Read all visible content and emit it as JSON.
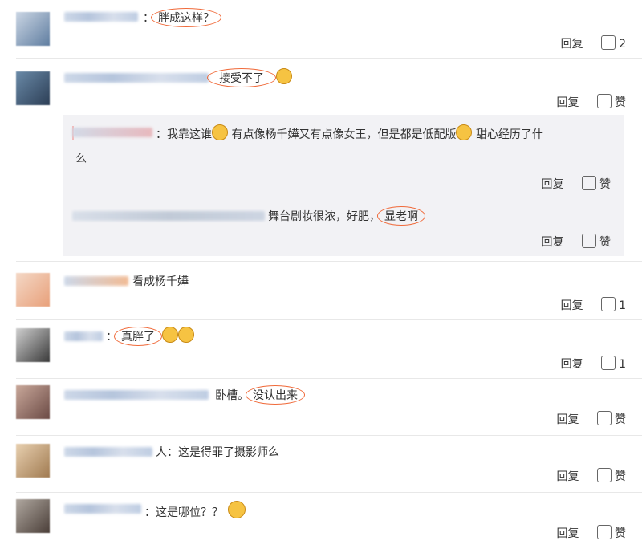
{
  "comments": [
    {
      "text": "：",
      "highlight": "胖成这样？",
      "reply": "回复",
      "like": "2"
    },
    {
      "text": "",
      "highlight": "接受不了",
      "emoji": true,
      "reply": "回复",
      "like": "赞"
    },
    {
      "text": "看成杨千嬅",
      "reply": "回复",
      "like": "1"
    },
    {
      "text": "：",
      "highlight": "真胖了",
      "emoji2": true,
      "reply": "回复",
      "like": "1"
    },
    {
      "text": "卧槽。",
      "highlight": "没认出来",
      "reply": "回复",
      "like": "赞"
    },
    {
      "text": "人：这是得罪了摄影师么",
      "reply": "回复",
      "like": "赞"
    },
    {
      "text": "：这是哪位？？",
      "emoji": true,
      "reply": "回复",
      "like": "赞"
    }
  ],
  "subreplies": [
    {
      "text_line1": "：我靠这谁",
      "text_mid": "有点像杨千嬅又有点像女王，但是都是低配版",
      "text_end": "甜心经历了什",
      "text_line2": "么",
      "reply": "回复",
      "like": "赞"
    },
    {
      "prefix": "valerie_cat",
      "text": "舞台剧妆很浓，好肥，",
      "highlight": "显老啊",
      "reply": "回复",
      "like": "赞"
    }
  ]
}
